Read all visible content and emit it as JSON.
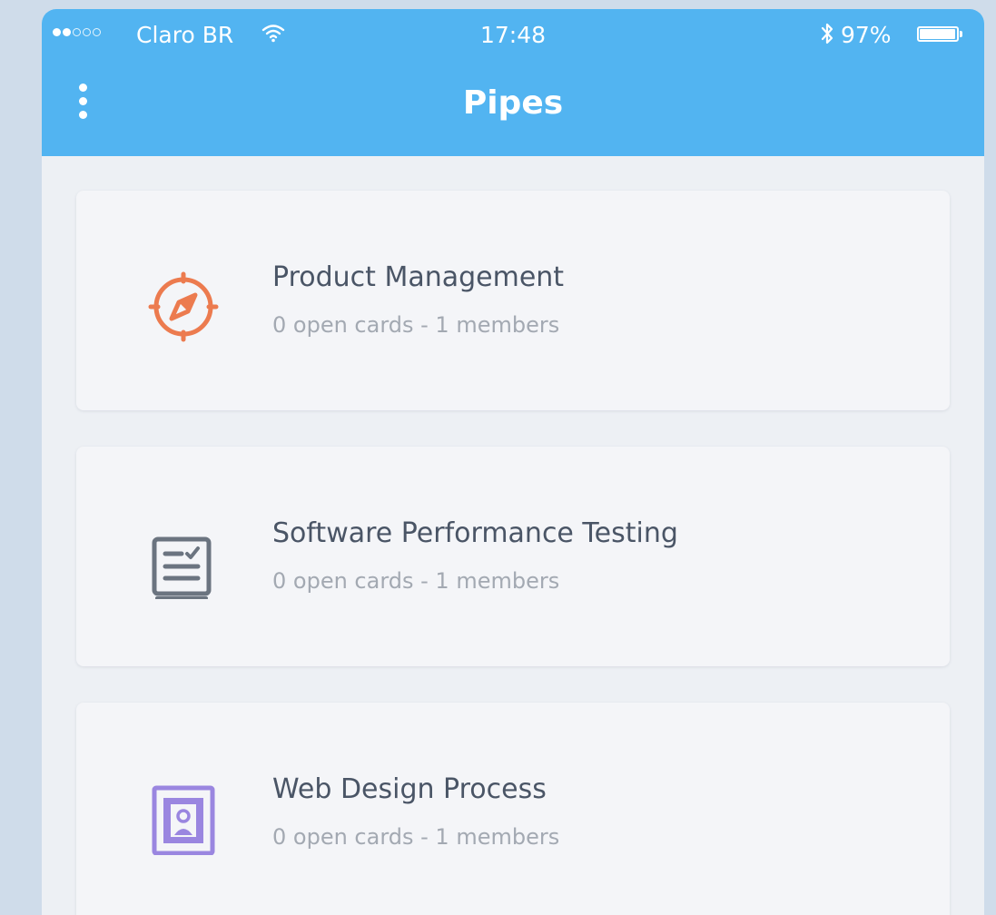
{
  "status_bar": {
    "carrier": "Claro BR",
    "time": "17:48",
    "battery_percent": "97%",
    "battery_level": 0.97,
    "signal_bars_filled": 2,
    "signal_bars_total": 5
  },
  "header": {
    "title": "Pipes",
    "background_color": "#52b4f1"
  },
  "pipes": [
    {
      "name": "Product Management",
      "details": "0 open cards - 1 members",
      "icon": "compass-icon",
      "icon_color": "#ec7b4f"
    },
    {
      "name": "Software Performance Testing",
      "details": "0 open cards - 1 members",
      "icon": "checklist-document-icon",
      "icon_color": "#6b7480"
    },
    {
      "name": "Web Design Process",
      "details": "0 open cards - 1 members",
      "icon": "framed-portrait-icon",
      "icon_color": "#9a86e0"
    }
  ]
}
